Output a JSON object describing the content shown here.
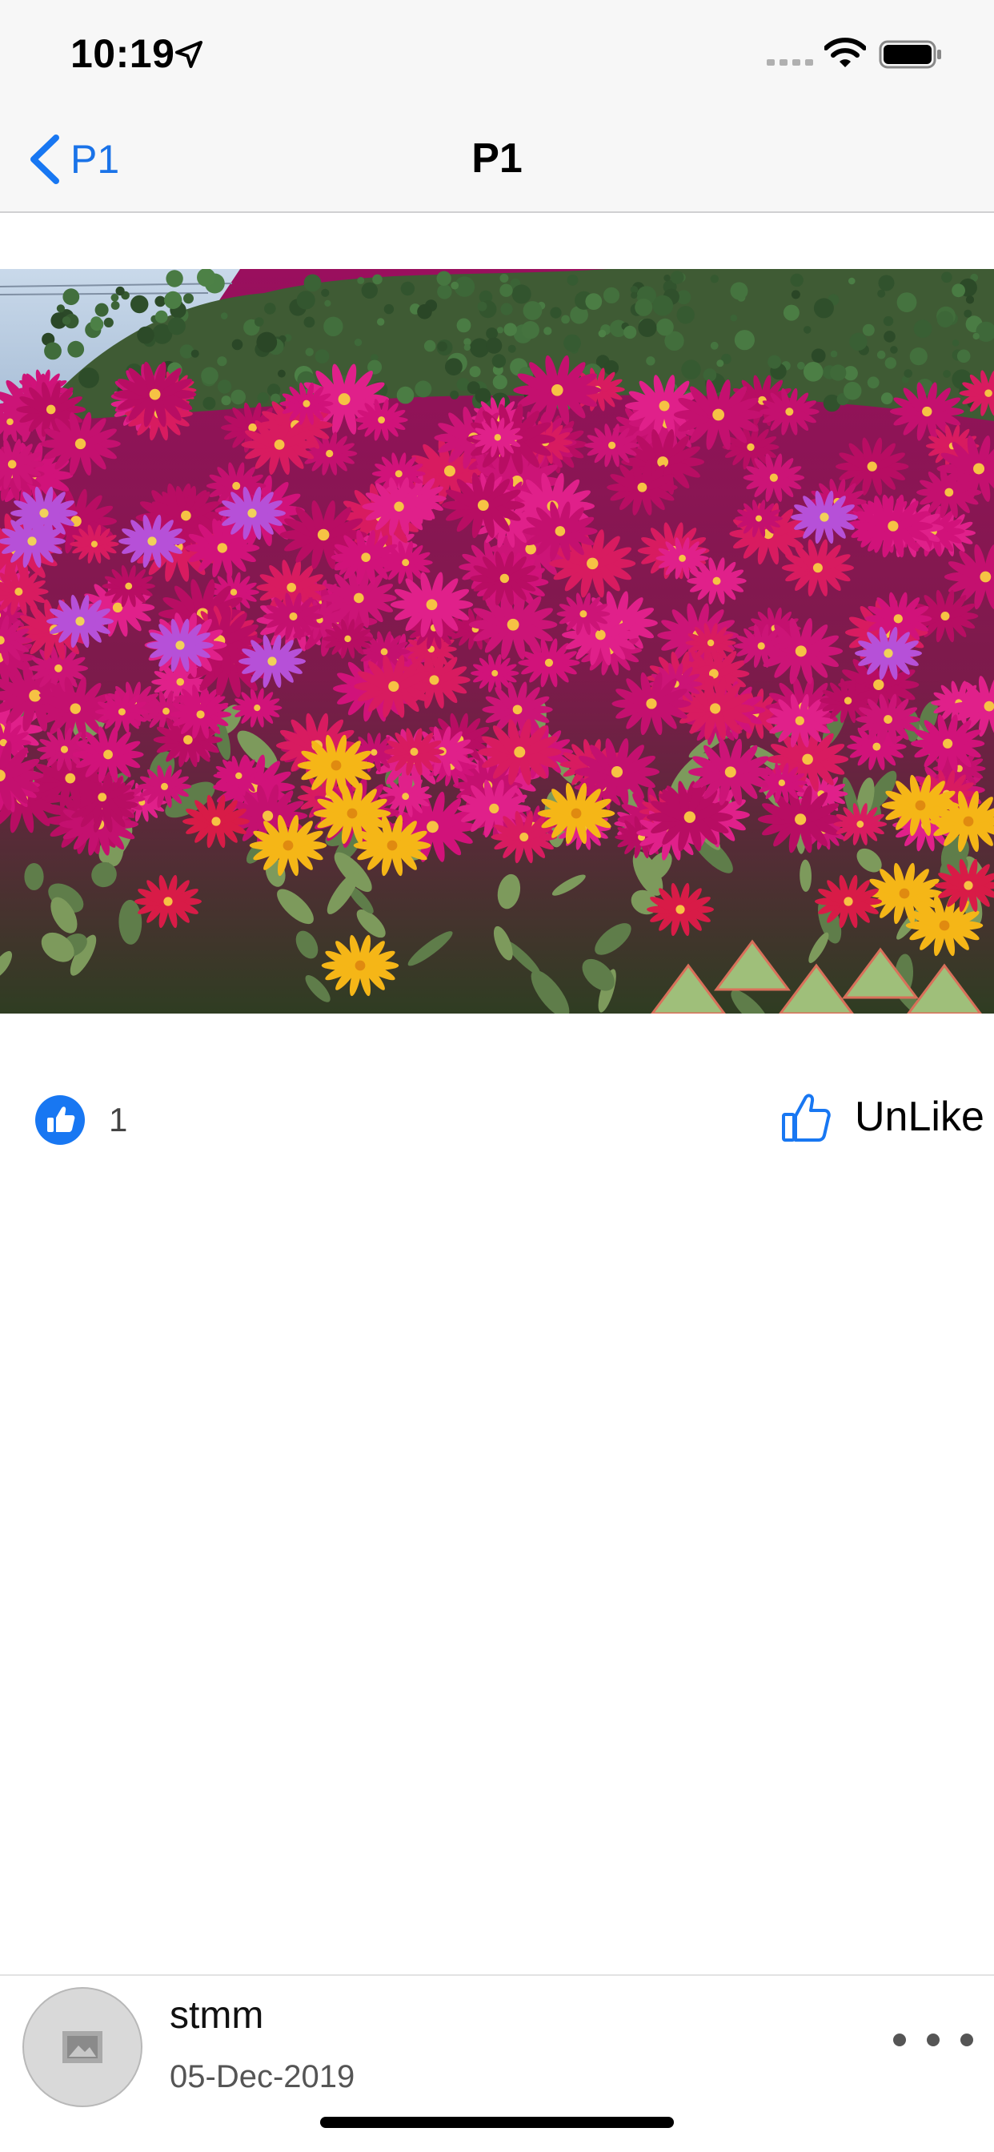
{
  "status_bar": {
    "time": "10:19"
  },
  "nav": {
    "back_label": "P1",
    "title": "P1"
  },
  "post": {
    "like_count": "1",
    "unlike_label": "UnLike",
    "author": "stmm",
    "date": "05-Dec-2019"
  },
  "colors": {
    "accent": "#1877f2",
    "nav_bg": "#f7f7f7"
  },
  "icons": {
    "back": "chevron-left-icon",
    "location": "location-arrow-icon",
    "wifi": "wifi-icon",
    "battery": "battery-icon",
    "like_badge": "thumbs-up-filled-icon",
    "unlike": "thumbs-up-outline-icon",
    "avatar": "image-placeholder-icon",
    "more": "ellipsis-icon"
  }
}
